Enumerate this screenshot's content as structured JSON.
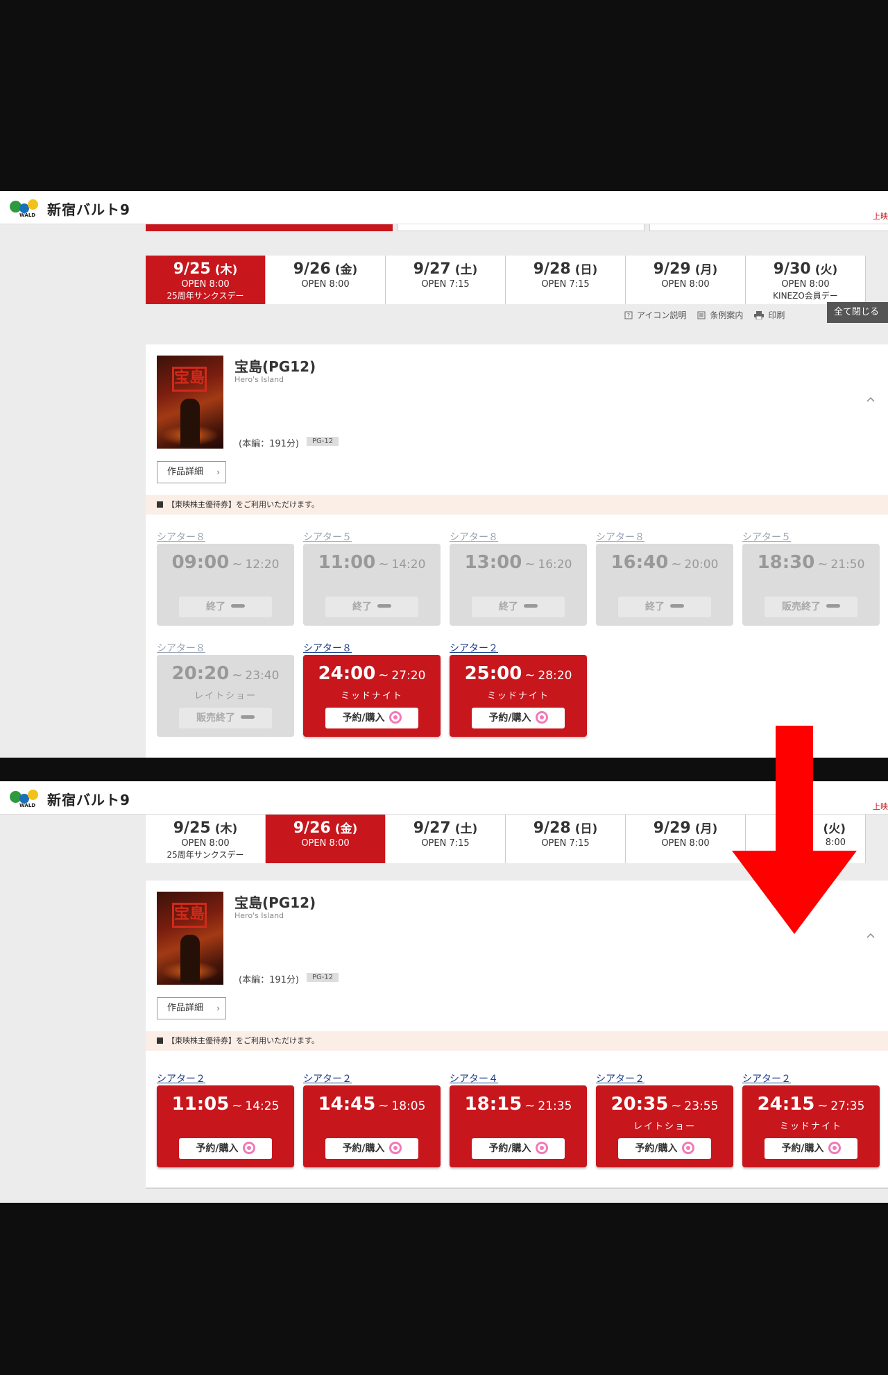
{
  "site": {
    "name": "新宿バルト9",
    "logo_text": "WALD",
    "top_right": "上映"
  },
  "dates": [
    {
      "date": "9/25",
      "weekday": "(木)",
      "open": "OPEN 8:00",
      "note": "25周年サンクスデー"
    },
    {
      "date": "9/26",
      "weekday": "(金)",
      "open": "OPEN 8:00",
      "note": ""
    },
    {
      "date": "9/27",
      "weekday": "(土)",
      "open": "OPEN 7:15",
      "note": ""
    },
    {
      "date": "9/28",
      "weekday": "(日)",
      "open": "OPEN 7:15",
      "note": ""
    },
    {
      "date": "9/29",
      "weekday": "(月)",
      "open": "OPEN 8:00",
      "note": ""
    },
    {
      "date": "9/30",
      "weekday": "(火)",
      "open": "OPEN 8:00",
      "note": "KINEZO会員デー"
    }
  ],
  "tools": {
    "icon_help": "アイコン説明",
    "terms": "条例案内",
    "print": "印刷",
    "close_all": "全て閉じる"
  },
  "movie": {
    "title": "宝島(PG12)",
    "subtitle": "Hero's Island",
    "runtime": "(本編：191分)",
    "rating": "PG-12",
    "poster_text": "宝島",
    "detail_button": "作品詳細",
    "notice": "【東映株主優待券】をご利用いただけます。"
  },
  "screenshot_a": {
    "selected_date": "9/25",
    "showtimes": [
      {
        "theater": "シアター８",
        "start": "09:00",
        "end": "12:20",
        "label": "",
        "status": "終了",
        "available": false
      },
      {
        "theater": "シアター５",
        "start": "11:00",
        "end": "14:20",
        "label": "",
        "status": "終了",
        "available": false
      },
      {
        "theater": "シアター８",
        "start": "13:00",
        "end": "16:20",
        "label": "",
        "status": "終了",
        "available": false
      },
      {
        "theater": "シアター８",
        "start": "16:40",
        "end": "20:00",
        "label": "",
        "status": "終了",
        "available": false
      },
      {
        "theater": "シアター５",
        "start": "18:30",
        "end": "21:50",
        "label": "",
        "status": "販売終了",
        "available": false
      },
      {
        "theater": "シアター８",
        "start": "20:20",
        "end": "23:40",
        "label": "レイトショー",
        "status": "販売終了",
        "available": false
      },
      {
        "theater": "シアター８",
        "start": "24:00",
        "end": "27:20",
        "label": "ミッドナイト",
        "status": "予約/購入",
        "available": true
      },
      {
        "theater": "シアター２",
        "start": "25:00",
        "end": "28:20",
        "label": "ミッドナイト",
        "status": "予約/購入",
        "available": true
      }
    ]
  },
  "screenshot_b": {
    "selected_date": "9/26",
    "last_date_partial": {
      "weekday": "(火)",
      "open": "8:00"
    },
    "showtimes": [
      {
        "theater": "シアター２",
        "start": "11:05",
        "end": "14:25",
        "label": "",
        "status": "予約/購入",
        "available": true
      },
      {
        "theater": "シアター２",
        "start": "14:45",
        "end": "18:05",
        "label": "",
        "status": "予約/購入",
        "available": true
      },
      {
        "theater": "シアター４",
        "start": "18:15",
        "end": "21:35",
        "label": "",
        "status": "予約/購入",
        "available": true
      },
      {
        "theater": "シアター２",
        "start": "20:35",
        "end": "23:55",
        "label": "レイトショー",
        "status": "予約/購入",
        "available": true
      },
      {
        "theater": "シアター２",
        "start": "24:15",
        "end": "27:35",
        "label": "ミッドナイト",
        "status": "予約/購入",
        "available": true
      }
    ]
  },
  "colors": {
    "accent": "#c8161d",
    "arrow": "#ff0000",
    "ended": "#dcdcdc",
    "notice_bg": "#fbeee6"
  }
}
